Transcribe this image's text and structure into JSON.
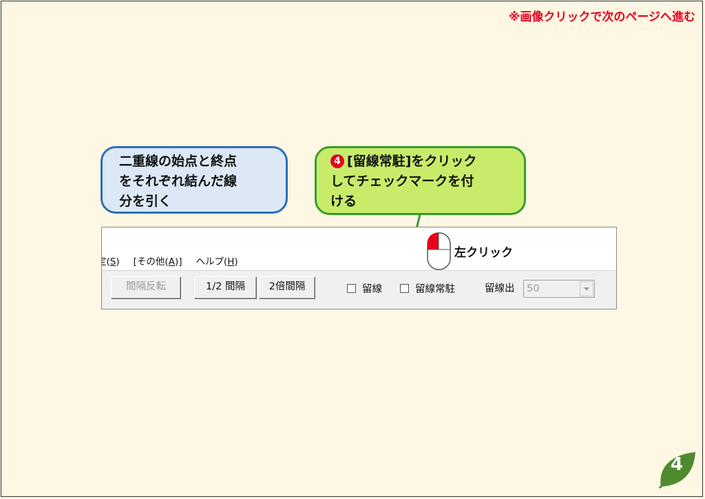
{
  "notice": "※画像クリックで次のページへ進む",
  "callout_blue": {
    "lines": [
      "二重線の始点と終点",
      "をそれぞれ結んだ線",
      "分を引く"
    ]
  },
  "callout_green": {
    "step": "4",
    "lines": [
      "[留線常駐]をクリック",
      "してチェックマークを付",
      "ける"
    ]
  },
  "screenshot": {
    "menu": [
      {
        "pre": "定(",
        "key": "S",
        "post": ")"
      },
      {
        "pre": "[その他(",
        "key": "A",
        "post": ")]"
      },
      {
        "pre": "ヘルプ(",
        "key": "H",
        "post": ")"
      }
    ],
    "buttons": {
      "flip_spacing": "間隔反転",
      "half_spacing": "1/2 間隔",
      "double_spacing": "2倍間隔"
    },
    "checkboxes": {
      "tome_line": "留線",
      "tome_resident": "留線常駐"
    },
    "tome_out_label": "留線出",
    "tome_out_value": "50"
  },
  "mouse_label": "左クリック",
  "page_number": "4",
  "colors": {
    "red": "#e8001c",
    "blue_border": "#2d6fb7",
    "green_border": "#3a9a2c",
    "leaf": "#4f8a2e"
  }
}
